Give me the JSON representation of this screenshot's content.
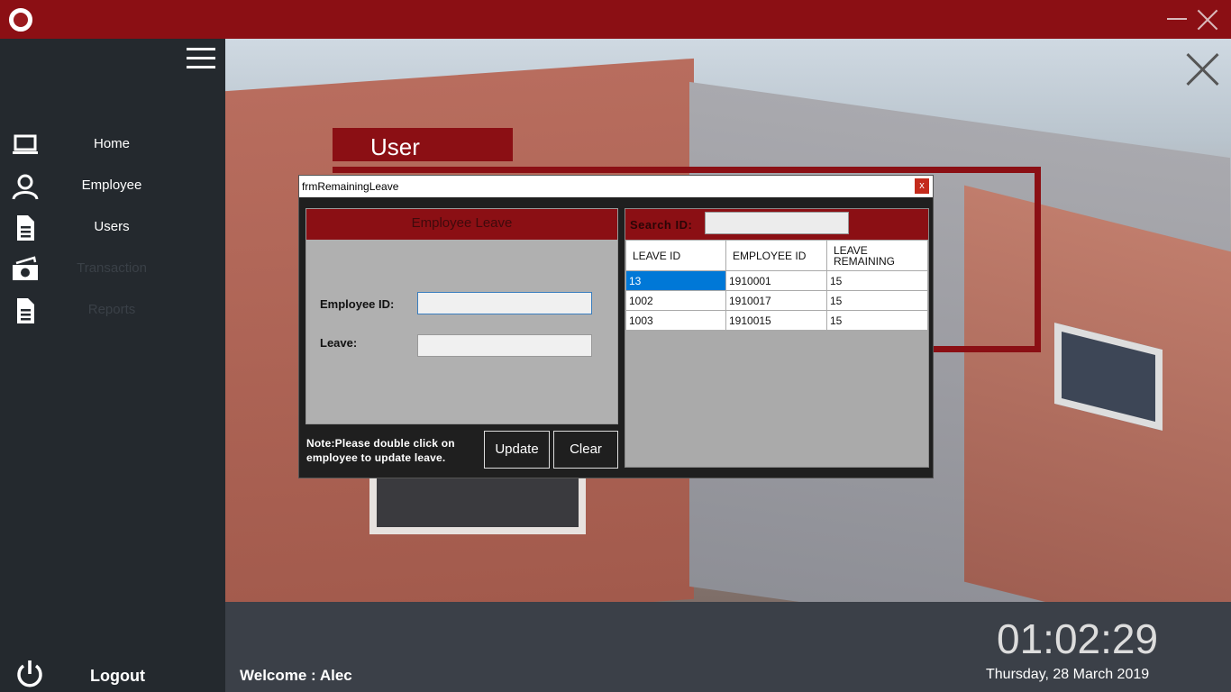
{
  "titlebar": {
    "logo": "college-seal-logo",
    "minimize_icon": "minimize-icon",
    "close_icon": "close-icon"
  },
  "sidebar": {
    "menu_icon": "hamburger-menu-icon",
    "items": [
      {
        "label": "Home",
        "icon": "laptop-icon",
        "enabled": true
      },
      {
        "label": "Employee",
        "icon": "user-icon",
        "enabled": true
      },
      {
        "label": "Users",
        "icon": "document-icon",
        "enabled": true
      },
      {
        "label": "Transaction",
        "icon": "money-icon",
        "enabled": false
      },
      {
        "label": "Reports",
        "icon": "report-icon",
        "enabled": false
      }
    ],
    "logout_label": "Logout",
    "logout_icon": "power-icon"
  },
  "main": {
    "section_title": "User",
    "close_icon": "close-icon"
  },
  "footer": {
    "welcome_prefix": "Welcome : ",
    "username": "Alec",
    "time": "01:02:29",
    "date": "Thursday, 28 March 2019"
  },
  "dialog": {
    "title": "frmRemainingLeave",
    "close_label": "x",
    "left_panel": {
      "header": "Employee Leave",
      "employee_id_label": "Employee ID:",
      "employee_id_value": "",
      "leave_label": "Leave:",
      "leave_value": ""
    },
    "note": "Note:Please double click on employee to update leave.",
    "update_button": "Update",
    "clear_button": "Clear",
    "right_panel": {
      "search_label": "Search ID:",
      "search_value": "",
      "columns": [
        "LEAVE ID",
        "EMPLOYEE ID",
        "LEAVE REMAINING"
      ],
      "rows": [
        [
          "13",
          "1910001",
          "15"
        ],
        [
          "1002",
          "1910017",
          "15"
        ],
        [
          "1003",
          "1910015",
          "15"
        ]
      ],
      "selected_row": 0
    }
  },
  "colors": {
    "brand_red": "#8b0f14",
    "sidebar": "#24292e",
    "footer": "#3b4048",
    "selection": "#0078d7"
  }
}
